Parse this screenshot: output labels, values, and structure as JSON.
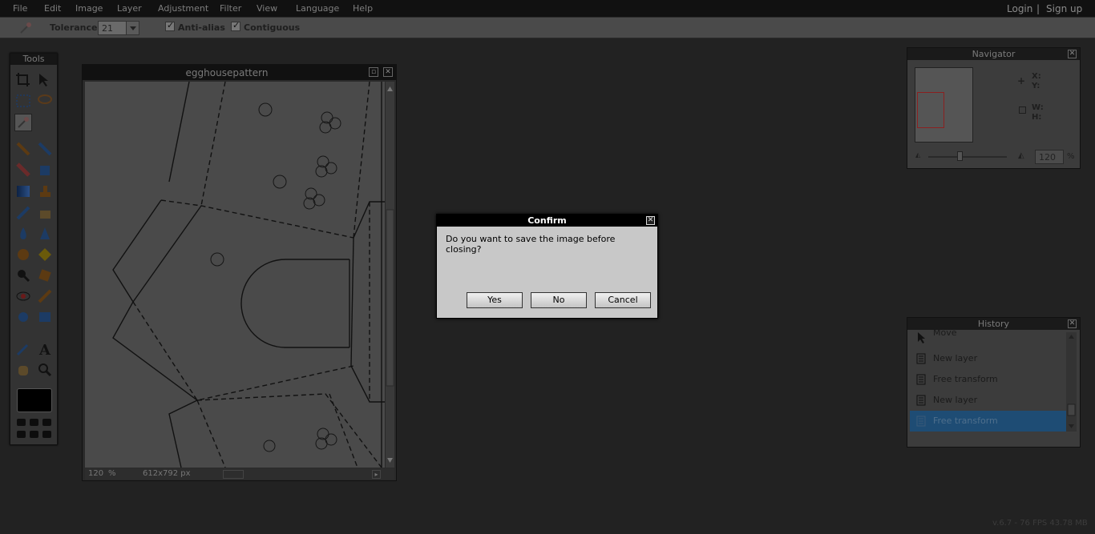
{
  "menubar": {
    "items": [
      "File",
      "Edit",
      "Image",
      "Layer",
      "Adjustment",
      "Filter",
      "View",
      "Language",
      "Help"
    ],
    "login": "Login",
    "separator": "|",
    "signup": "Sign up"
  },
  "options": {
    "tolerance_label": "Tolerance:",
    "tolerance_value": "21",
    "antialias_label": "Anti-alias",
    "contiguous_label": "Contiguous"
  },
  "tools": {
    "title": "Tools"
  },
  "document": {
    "title": "egghousepattern",
    "zoom": "120",
    "zoom_unit": "%",
    "dimensions": "612x792 px"
  },
  "dialog": {
    "title": "Confirm",
    "close": "✕",
    "message": "Do you want to save the image before closing?",
    "yes": "Yes",
    "no": "No",
    "cancel": "Cancel"
  },
  "navigator": {
    "title": "Navigator",
    "x_label": "X:",
    "y_label": "Y:",
    "w_label": "W:",
    "h_label": "H:",
    "zoom_value": "120",
    "zoom_unit": "%"
  },
  "history": {
    "title": "History",
    "items": [
      {
        "label": "Move",
        "icon": "move-icon"
      },
      {
        "label": "New layer",
        "icon": "layer-icon"
      },
      {
        "label": "Free transform",
        "icon": "layer-icon"
      },
      {
        "label": "New layer",
        "icon": "layer-icon"
      },
      {
        "label": "Free transform",
        "icon": "layer-icon",
        "selected": true
      }
    ]
  },
  "status": {
    "version": "v.6.7 - 76 FPS 43.78 MB"
  }
}
